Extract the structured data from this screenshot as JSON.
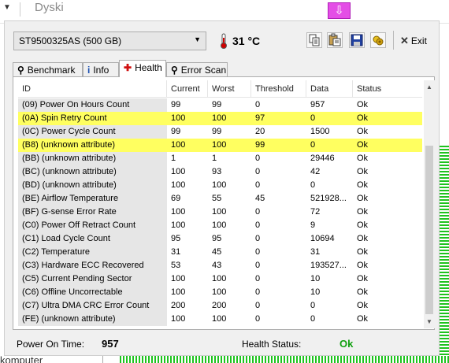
{
  "background": {
    "app_title": "Dyski",
    "bottom_text": "komputer"
  },
  "drive": {
    "selected": "ST9500325AS (500 GB)",
    "temperature": "31 °C"
  },
  "toolbar": {
    "exit_label": "Exit",
    "icons": [
      "copy-icon",
      "paste-icon",
      "save-icon",
      "refresh-icon"
    ]
  },
  "tabs": [
    {
      "label": "Benchmark",
      "icon": "benchmark-icon"
    },
    {
      "label": "Info",
      "icon": "info-icon"
    },
    {
      "label": "Health",
      "icon": "health-cross-icon",
      "active": true
    },
    {
      "label": "Error Scan",
      "icon": "magnifier-icon"
    }
  ],
  "table": {
    "columns": [
      "ID",
      "Current",
      "Worst",
      "Threshold",
      "Data",
      "Status"
    ],
    "rows": [
      {
        "id": "(09) Power On Hours Count",
        "current": "99",
        "worst": "99",
        "threshold": "0",
        "data": "957",
        "status": "Ok",
        "highlight": false
      },
      {
        "id": "(0A) Spin Retry Count",
        "current": "100",
        "worst": "100",
        "threshold": "97",
        "data": "0",
        "status": "Ok",
        "highlight": true
      },
      {
        "id": "(0C) Power Cycle Count",
        "current": "99",
        "worst": "99",
        "threshold": "20",
        "data": "1500",
        "status": "Ok",
        "highlight": false
      },
      {
        "id": "(B8) (unknown attribute)",
        "current": "100",
        "worst": "100",
        "threshold": "99",
        "data": "0",
        "status": "Ok",
        "highlight": true
      },
      {
        "id": "(BB) (unknown attribute)",
        "current": "1",
        "worst": "1",
        "threshold": "0",
        "data": "29446",
        "status": "Ok",
        "highlight": false
      },
      {
        "id": "(BC) (unknown attribute)",
        "current": "100",
        "worst": "93",
        "threshold": "0",
        "data": "42",
        "status": "Ok",
        "highlight": false
      },
      {
        "id": "(BD) (unknown attribute)",
        "current": "100",
        "worst": "100",
        "threshold": "0",
        "data": "0",
        "status": "Ok",
        "highlight": false
      },
      {
        "id": "(BE) Airflow Temperature",
        "current": "69",
        "worst": "55",
        "threshold": "45",
        "data": "521928...",
        "status": "Ok",
        "highlight": false
      },
      {
        "id": "(BF) G-sense Error Rate",
        "current": "100",
        "worst": "100",
        "threshold": "0",
        "data": "72",
        "status": "Ok",
        "highlight": false
      },
      {
        "id": "(C0) Power Off Retract Count",
        "current": "100",
        "worst": "100",
        "threshold": "0",
        "data": "9",
        "status": "Ok",
        "highlight": false
      },
      {
        "id": "(C1) Load Cycle Count",
        "current": "95",
        "worst": "95",
        "threshold": "0",
        "data": "10694",
        "status": "Ok",
        "highlight": false
      },
      {
        "id": "(C2) Temperature",
        "current": "31",
        "worst": "45",
        "threshold": "0",
        "data": "31",
        "status": "Ok",
        "highlight": false
      },
      {
        "id": "(C3) Hardware ECC Recovered",
        "current": "53",
        "worst": "43",
        "threshold": "0",
        "data": "193527...",
        "status": "Ok",
        "highlight": false
      },
      {
        "id": "(C5) Current Pending Sector",
        "current": "100",
        "worst": "100",
        "threshold": "0",
        "data": "10",
        "status": "Ok",
        "highlight": false
      },
      {
        "id": "(C6) Offline Uncorrectable",
        "current": "100",
        "worst": "100",
        "threshold": "0",
        "data": "10",
        "status": "Ok",
        "highlight": false
      },
      {
        "id": "(C7) Ultra DMA CRC Error Count",
        "current": "200",
        "worst": "200",
        "threshold": "0",
        "data": "0",
        "status": "Ok",
        "highlight": false
      },
      {
        "id": "(FE) (unknown attribute)",
        "current": "100",
        "worst": "100",
        "threshold": "0",
        "data": "0",
        "status": "Ok",
        "highlight": false
      }
    ]
  },
  "status": {
    "power_on_label": "Power On Time:",
    "power_on_value": "957",
    "health_label": "Health Status:",
    "health_value": "Ok"
  },
  "colors": {
    "highlight": "#ffff60",
    "ok_green": "#10a010",
    "temperature_red": "#d00000"
  }
}
